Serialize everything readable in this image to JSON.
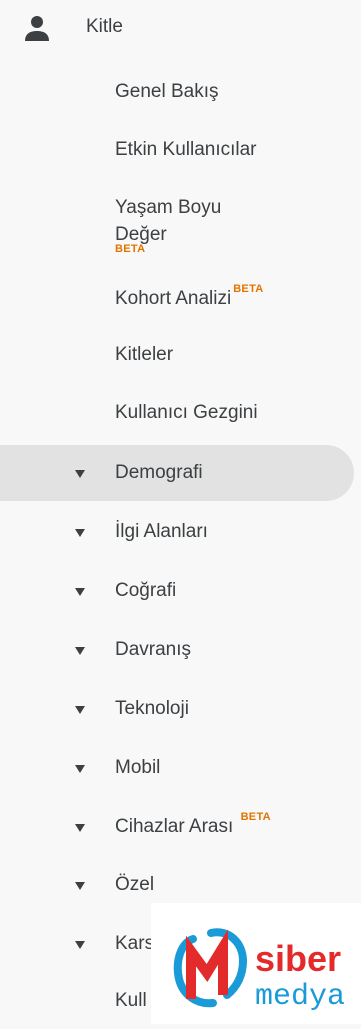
{
  "header": {
    "label": "Kitle",
    "icon": "person-icon"
  },
  "sub_items": [
    {
      "label": "Genel Bakış"
    },
    {
      "label": "Etkin Kullanıcılar"
    },
    {
      "label_line1": "Yaşam Boyu",
      "label_line2": "Değer",
      "badge": "BETA"
    },
    {
      "label": "Kohort Analizi",
      "badge": "BETA"
    },
    {
      "label": "Kitleler"
    },
    {
      "label": "Kullanıcı Gezgini"
    }
  ],
  "categories": [
    {
      "label": "Demografi",
      "active": true
    },
    {
      "label": "İlgi Alanları"
    },
    {
      "label": "Coğrafi"
    },
    {
      "label": "Davranış"
    },
    {
      "label": "Teknoloji"
    },
    {
      "label": "Mobil"
    },
    {
      "label": "Cihazlar Arası",
      "badge": "BETA"
    },
    {
      "label": "Özel"
    },
    {
      "label": "Kars"
    },
    {
      "label": "Kull"
    }
  ],
  "watermark": {
    "line1": "siber",
    "line2": "medya",
    "icon": "siber-medya-logo-icon"
  },
  "colors": {
    "active_bg": "#e2e2e2",
    "beta": "#e37400",
    "text": "#3c4043"
  }
}
